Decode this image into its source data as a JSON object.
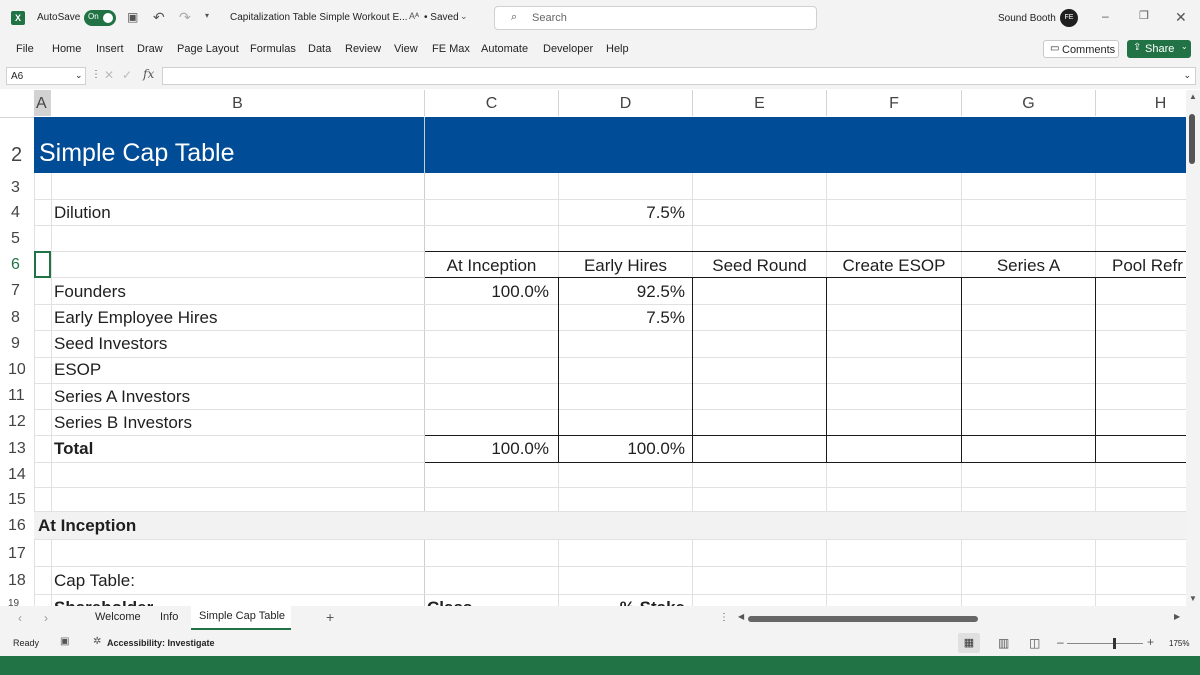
{
  "titlebar": {
    "autosave_label": "AutoSave",
    "autosave_state": "On",
    "file_name": "Capitalization Table Simple Workout E...",
    "saved_label": "• Saved",
    "search_placeholder": "Search",
    "user_name": "Sound Booth",
    "avatar_initials": "FE"
  },
  "ribbon_tabs": [
    "File",
    "Home",
    "Insert",
    "Draw",
    "Page Layout",
    "Formulas",
    "Data",
    "Review",
    "View",
    "FE Max",
    "Automate",
    "Developer",
    "Help"
  ],
  "ribbon_buttons": {
    "comments": "Comments",
    "share": "Share"
  },
  "formula_bar": {
    "name_box": "A6",
    "formula": "",
    "fx_label": "fx"
  },
  "columns": [
    "A",
    "B",
    "C",
    "D",
    "E",
    "F",
    "G",
    "H"
  ],
  "rows": [
    "2",
    "3",
    "4",
    "5",
    "6",
    "7",
    "8",
    "9",
    "10",
    "11",
    "12",
    "13",
    "14",
    "15",
    "16",
    "17",
    "18",
    "19"
  ],
  "sheet": {
    "title": "Simple Cap Table",
    "dilution_label": "Dilution",
    "dilution_value": "7.5%",
    "headers": [
      "At Inception",
      "Early Hires",
      "Seed Round",
      "Create ESOP",
      "Series A",
      "Pool Refr"
    ],
    "shareholders": [
      "Founders",
      "Early Employee Hires",
      "Seed Investors",
      "ESOP",
      "Series A Investors",
      "Series B Investors"
    ],
    "c_values": [
      "100.0%",
      "",
      "",
      "",
      "",
      ""
    ],
    "d_values": [
      "92.5%",
      "7.5%",
      "",
      "",
      "",
      ""
    ],
    "total_label": "Total",
    "total_c": "100.0%",
    "total_d": "100.0%",
    "section_title": "At Inception",
    "cap_table_label": "Cap Table:",
    "row19_b": "Shareholder",
    "row19_c": "Class",
    "row19_d": "% Stake"
  },
  "sheet_tabs": [
    "Welcome",
    "Info",
    "Simple Cap Table"
  ],
  "active_sheet": "Simple Cap Table",
  "status": {
    "ready": "Ready",
    "accessibility": "Accessibility: Investigate",
    "zoom": "175%"
  },
  "colors": {
    "title_band": "#004c97",
    "excel_green": "#217346"
  }
}
